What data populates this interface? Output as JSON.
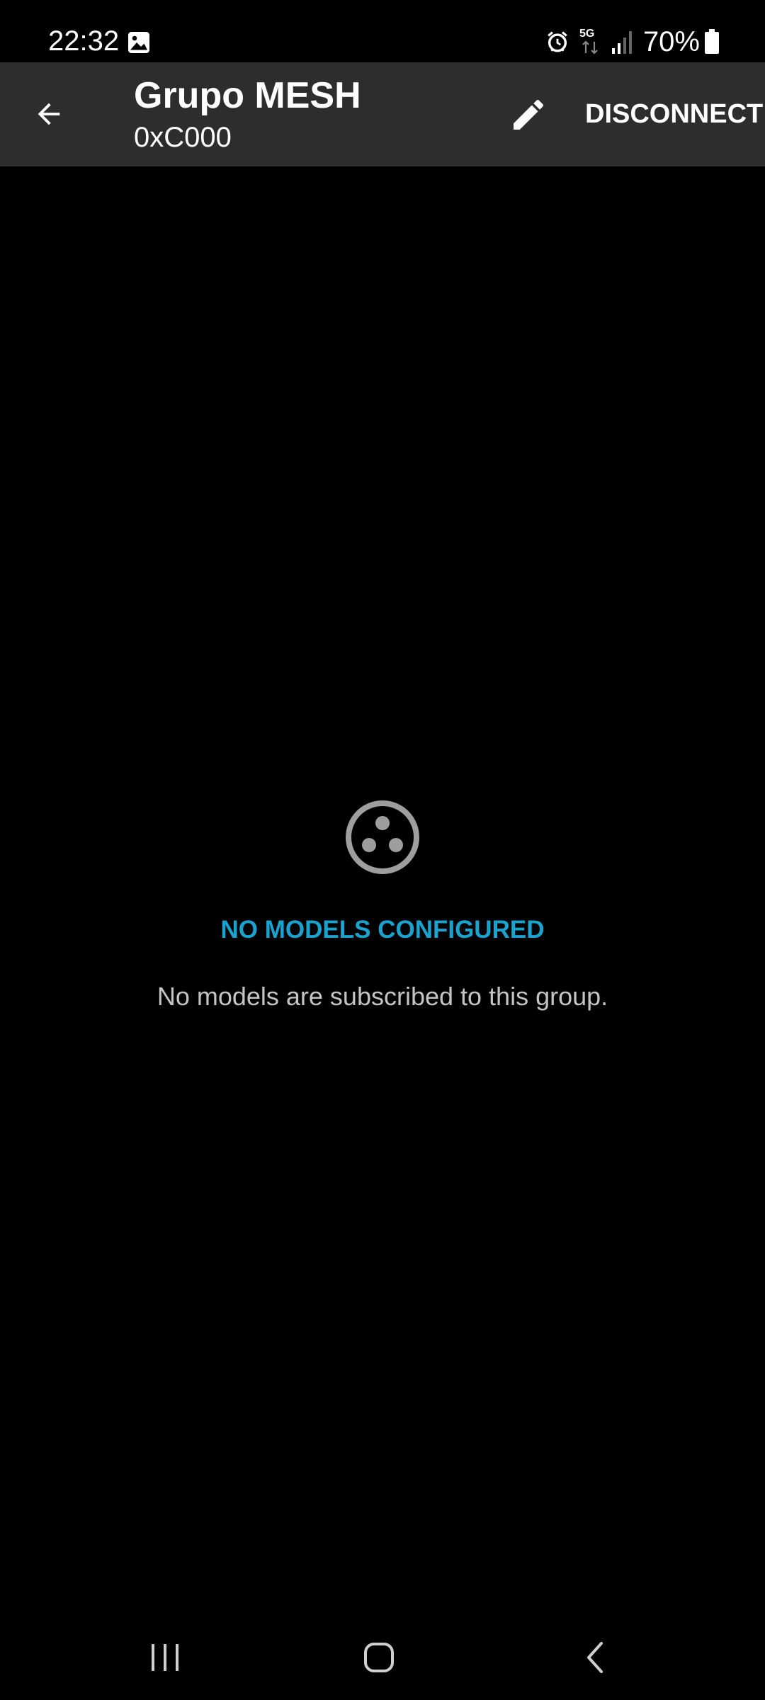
{
  "status_bar": {
    "time": "22:32",
    "network": "5G",
    "battery": "70%",
    "icons": [
      "gallery-icon",
      "alarm-icon",
      "network-5g-icon",
      "signal-icon",
      "battery-icon"
    ]
  },
  "app_bar": {
    "title": "Grupo MESH",
    "subtitle": "0xC000",
    "back_icon": "arrow-back-icon",
    "edit_icon": "pencil-icon",
    "disconnect_label": "DISCONNECT"
  },
  "empty_state": {
    "icon": "models-icon",
    "title": "NO MODELS CONFIGURED",
    "message": "No models are subscribed to this group."
  },
  "nav_bar": {
    "icons": [
      "recent-apps-icon",
      "home-icon",
      "back-icon"
    ]
  },
  "colors": {
    "background": "#000000",
    "app_bar": "#2d2d2d",
    "accent": "#1aa3cf",
    "secondary_text": "#c4c4c4",
    "icon_gray": "#9e9e9e"
  }
}
